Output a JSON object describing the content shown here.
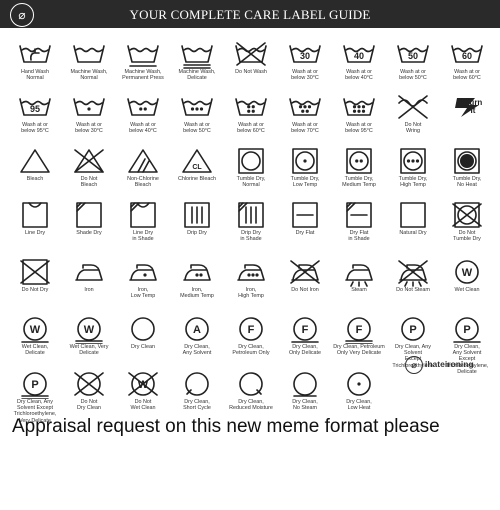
{
  "header": {
    "title": "YOUR COMPLETE CARE LABEL GUIDE"
  },
  "rows": [
    [
      {
        "icon": "tub-hand",
        "label": "Hand Wash\nNormal"
      },
      {
        "icon": "tub",
        "label": "Machine Wash,\nNormal"
      },
      {
        "icon": "tub-bar",
        "label": "Machine Wash,\nPermanent Press"
      },
      {
        "icon": "tub-bar2",
        "label": "Machine Wash,\nDelicate"
      },
      {
        "icon": "tub-x",
        "label": "Do Not Wash"
      },
      {
        "icon": "tub-num",
        "num": "30",
        "label": "Wash at or\nbelow 30°C"
      },
      {
        "icon": "tub-num",
        "num": "40",
        "label": "Wash at or\nbelow 40°C"
      },
      {
        "icon": "tub-num",
        "num": "50",
        "label": "Wash at or\nbelow 50°C"
      },
      {
        "icon": "tub-num",
        "num": "60",
        "label": "Wash at or\nbelow 60°C"
      }
    ],
    [
      {
        "icon": "tub-num",
        "num": "95",
        "label": "Wash at or\nbelow 95°C"
      },
      {
        "icon": "tub-dots",
        "dots": 1,
        "label": "Wash at or\nbelow 30°C"
      },
      {
        "icon": "tub-dots",
        "dots": 2,
        "label": "Wash at or\nbelow 40°C"
      },
      {
        "icon": "tub-dots",
        "dots": 3,
        "label": "Wash at or\nbelow 50°C"
      },
      {
        "icon": "tub-dots",
        "dots": 4,
        "label": "Wash at or\nbelow 60°C"
      },
      {
        "icon": "tub-dots",
        "dots": 5,
        "label": "Wash at or\nbelow 70°C"
      },
      {
        "icon": "tub-dots",
        "dots": 6,
        "label": "Wash at or\nbelow 95°C"
      },
      {
        "icon": "wring-x",
        "label": "Do Not\nWring"
      },
      {
        "icon": "burn",
        "text": "Burn\nIt",
        "label": ""
      }
    ],
    [
      {
        "icon": "tri",
        "label": "Bleach"
      },
      {
        "icon": "tri-x",
        "label": "Do Not\nBleach"
      },
      {
        "icon": "tri-lines",
        "label": "Non-Chlorine\nBleach"
      },
      {
        "icon": "tri-cl",
        "text": "CL",
        "label": "Chlorine Bleach"
      },
      {
        "icon": "sq-circle",
        "label": "Tumble Dry,\nNormal"
      },
      {
        "icon": "sq-circle-dot",
        "dots": 1,
        "label": "Tumble Dry,\nLow Temp"
      },
      {
        "icon": "sq-circle-dot",
        "dots": 2,
        "label": "Tumble Dry,\nMedium Temp"
      },
      {
        "icon": "sq-circle-dot",
        "dots": 3,
        "label": "Tumble Dry,\nHigh Temp"
      },
      {
        "icon": "sq-circle-fill",
        "label": "Tumble Dry,\nNo Heat"
      }
    ],
    [
      {
        "icon": "sq-line",
        "label": "Line Dry"
      },
      {
        "icon": "sq-shade",
        "label": "Shade Dry"
      },
      {
        "icon": "sq-line-shade",
        "label": "Line Dry\nin Shade"
      },
      {
        "icon": "sq-drip",
        "label": "Drip Dry"
      },
      {
        "icon": "sq-drip-shade",
        "label": "Drip Dry\nin Shade"
      },
      {
        "icon": "sq-flat",
        "label": "Dry Flat"
      },
      {
        "icon": "sq-flat-shade",
        "label": "Dry Flat\nin Shade"
      },
      {
        "icon": "sq",
        "label": "Natural Dry"
      },
      {
        "icon": "sq-circle-x",
        "label": "Do Not\nTumble Dry"
      }
    ],
    [
      {
        "icon": "sq-x",
        "label": "Do Not Dry"
      },
      {
        "icon": "iron",
        "label": "Iron"
      },
      {
        "icon": "iron-dot",
        "dots": 1,
        "label": "Iron,\nLow Temp"
      },
      {
        "icon": "iron-dot",
        "dots": 2,
        "label": "Iron,\nMedium Temp"
      },
      {
        "icon": "iron-dot",
        "dots": 3,
        "label": "Iron,\nHigh Temp"
      },
      {
        "icon": "iron-x",
        "label": "Do Not Iron"
      },
      {
        "icon": "steam",
        "label": "Steam"
      },
      {
        "icon": "steam-x",
        "label": "Do Not Steam"
      },
      {
        "icon": "circ-letter",
        "text": "W",
        "label": "Wet Clean"
      }
    ],
    [
      {
        "icon": "circ-letter-bar",
        "text": "W",
        "label": "Wet Clean,\nDelicate"
      },
      {
        "icon": "circ-letter-bar2",
        "text": "W",
        "label": "Wet Clean, Very\nDelicate"
      },
      {
        "icon": "circ",
        "label": "Dry Clean"
      },
      {
        "icon": "circ-letter",
        "text": "A",
        "label": "Dry Clean,\nAny Solvent"
      },
      {
        "icon": "circ-letter",
        "text": "F",
        "label": "Dry Clean,\nPetroleum Only"
      },
      {
        "icon": "circ-letter-bar",
        "text": "F",
        "label": "Dry Clean,\nOnly Delicate"
      },
      {
        "icon": "circ-letter-bar2",
        "text": "F",
        "label": "Dry Clean, Petroleum\nOnly Very Delicate"
      },
      {
        "icon": "circ-letter",
        "text": "P",
        "label": "Dry Clean, Any Solvent\nExcept\nTrichloroethylene"
      },
      {
        "icon": "circ-letter-bar",
        "text": "P",
        "label": "Dry Clean,\nAny Solvent\nExcept\nTrichloroethylene,\nDelicate"
      }
    ],
    [
      {
        "icon": "circ-letter-bar2",
        "text": "P",
        "label": "Dry Clean, Any\nSolvent Except\nTrichloroethylene,\nVery Delicate"
      },
      {
        "icon": "circ-x",
        "label": "Do Not\nDry Clean"
      },
      {
        "icon": "circ-w-x",
        "text": "W",
        "label": "Do Not\nWet Clean"
      },
      {
        "icon": "circ-short",
        "label": "Dry Clean,\nShort Cycle"
      },
      {
        "icon": "circ-reduced",
        "label": "Dry Clean,\nReduced Moisture"
      },
      {
        "icon": "circ-nosteam",
        "label": "Dry Clean,\nNo Steam"
      },
      {
        "icon": "circ-low",
        "label": "Dry Clean,\nLow Heat"
      }
    ]
  ],
  "watermark": {
    "text": "ihateironing",
    "icon": "no-iron-icon"
  },
  "caption": "Appraisal request on this new meme format please"
}
